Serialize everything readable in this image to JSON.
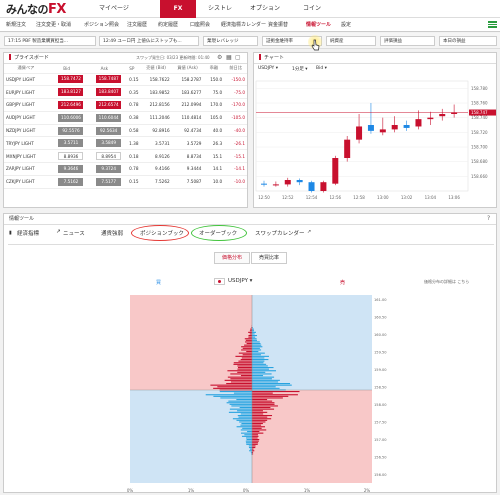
{
  "app": {
    "logo_text": "みんなの",
    "logo_fx": "FX",
    "nav_tabs": [
      "マイページ",
      "FX",
      "シストレ",
      "オプション",
      "コイン"
    ],
    "active_tab": "FX"
  },
  "menu": {
    "items": [
      "新規注文",
      "注文変更・取消",
      "ポジション照会",
      "注文履歴",
      "約定履歴",
      "口座照会",
      "経済指標カレンダー",
      "資金振替",
      "情報ツール",
      "設定"
    ]
  },
  "tickers": [
    {
      "label": "17:15 PBF 製造業購買担当..."
    },
    {
      "label": "12:49 ユーロ円 上値仏にストップも..."
    },
    {
      "label": "業現レバレッジ"
    },
    {
      "label": "証拠金維持率"
    },
    {
      "label": "純資産"
    },
    {
      "label": "評価損益"
    },
    {
      "label": "本日の損益"
    }
  ],
  "rateboard": {
    "title": "プライスボード",
    "swap_info": "スワップ発生日: 03/23 更新時間: 01:40",
    "columns": [
      "通貨ペア",
      "Bid",
      "Ask",
      "SP",
      "売値 (Bid)",
      "買値 (Ask)",
      "乖離",
      "前日比"
    ],
    "rows": [
      {
        "pair": "USDJPY LIGHT",
        "bid": "158.7472",
        "ask": "158.7487",
        "bid_style": "red",
        "ask_style": "red",
        "sp": "0.15",
        "sell": "158.7622",
        "buy": "158.2787",
        "dev": "150.0",
        "chg": "-150.0"
      },
      {
        "pair": "EURJPY LIGHT",
        "bid": "183.8127",
        "ask": "183.8407",
        "bid_style": "red",
        "ask_style": "red",
        "sp": "0.35",
        "sell": "183.9852",
        "buy": "183.6277",
        "dev": "75.0",
        "chg": "-75.0"
      },
      {
        "pair": "GBPJPY LIGHT",
        "bid": "212.6496",
        "ask": "212.6574",
        "bid_style": "red",
        "ask_style": "red",
        "sp": "0.78",
        "sell": "212.8156",
        "buy": "212.0994",
        "dev": "170.0",
        "chg": "-170.0"
      },
      {
        "pair": "AUDJPY LIGHT",
        "bid": "110.6006",
        "ask": "110.6044",
        "bid_style": "gray",
        "ask_style": "gray",
        "sp": "0.38",
        "sell": "111.2046",
        "buy": "110.4814",
        "dev": "105.0",
        "chg": "-105.0"
      },
      {
        "pair": "NZDJPY LIGHT",
        "bid": "92.5576",
        "ask": "92.5634",
        "bid_style": "gray",
        "ask_style": "gray",
        "sp": "0.58",
        "sell": "92.8916",
        "buy": "92.4734",
        "dev": "40.0",
        "chg": "-40.0"
      },
      {
        "pair": "TRYJPY LIGHT",
        "bid": "3.5711",
        "ask": "3.5849",
        "bid_style": "gray",
        "ask_style": "gray",
        "sp": "1.38",
        "sell": "3.5731",
        "buy": "3.5729",
        "dev": "26.3",
        "chg": "-26.1"
      },
      {
        "pair": "MXNJPY LIGHT",
        "bid": "8.8936",
        "ask": "8.8954",
        "bid_style": "white",
        "ask_style": "white",
        "sp": "0.18",
        "sell": "8.9126",
        "buy": "8.8734",
        "dev": "15.1",
        "chg": "-15.1"
      },
      {
        "pair": "ZARJPY LIGHT",
        "bid": "9.3646",
        "ask": "9.3724",
        "bid_style": "gray",
        "ask_style": "gray",
        "sp": "0.78",
        "sell": "9.4166",
        "buy": "9.3444",
        "dev": "14.1",
        "chg": "-14.1"
      },
      {
        "pair": "CZKJPY LIGHT",
        "bid": "7.5162",
        "ask": "7.5177",
        "bid_style": "gray",
        "ask_style": "gray",
        "sp": "0.15",
        "sell": "7.5262",
        "buy": "7.5087",
        "dev": "10.0",
        "chg": "-10.0"
      }
    ]
  },
  "chart": {
    "title": "チャート",
    "symbol": "USDJPY",
    "timeframe": "1分足",
    "side": "Bid",
    "current_price": "158.747",
    "y_ticks": [
      "158.780",
      "158.760",
      "158.740",
      "158.720",
      "158.700",
      "158.680",
      "158.660"
    ],
    "x_ticks": [
      "12:50",
      "12:52",
      "12:54",
      "12:56",
      "12:58",
      "13:00",
      "13:02",
      "13:04",
      "13:06"
    ],
    "color_up": "#c8102e",
    "color_down": "#1e88e5"
  },
  "chart_data": {
    "type": "candlestick",
    "x": [
      "12:50",
      "12:51",
      "12:52",
      "12:53",
      "12:54",
      "12:55",
      "12:56",
      "12:57",
      "12:58",
      "12:59",
      "13:00",
      "13:01",
      "13:02",
      "13:03",
      "13:04",
      "13:05",
      "13:06"
    ],
    "open": [
      158.65,
      158.649,
      158.649,
      158.655,
      158.652,
      158.64,
      158.65,
      158.685,
      158.71,
      158.73,
      158.72,
      158.724,
      158.73,
      158.728,
      158.738,
      158.742,
      158.745
    ],
    "close": [
      158.649,
      158.649,
      158.655,
      158.652,
      158.64,
      158.652,
      158.685,
      158.71,
      158.728,
      158.722,
      158.724,
      158.73,
      158.726,
      158.738,
      158.74,
      158.745,
      158.747
    ],
    "high": [
      158.654,
      158.653,
      158.658,
      158.657,
      158.654,
      158.654,
      158.688,
      158.715,
      158.745,
      158.76,
      158.74,
      158.742,
      158.736,
      158.75,
      158.748,
      158.752,
      158.758
    ],
    "low": [
      158.646,
      158.646,
      158.646,
      158.648,
      158.638,
      158.638,
      158.648,
      158.68,
      158.705,
      158.718,
      158.716,
      158.72,
      158.722,
      158.724,
      158.73,
      158.736,
      158.74
    ],
    "ylim": [
      158.64,
      158.79
    ]
  },
  "infotool": {
    "title": "情報ツール",
    "tabs": [
      "経済指標",
      "ニュース",
      "通貨強弱",
      "ポジションブック",
      "オーダーブック",
      "スワップカレンダー"
    ],
    "sub_tabs": [
      "価格分布",
      "売買比率"
    ],
    "buy_label": "買",
    "sell_label": "売",
    "symbol": "USDJPY",
    "note": "価格分布の詳細は こちら",
    "x_ticks": [
      "0%",
      "1%",
      "2%",
      "1%",
      "0%",
      "1%",
      "2%"
    ],
    "y_ticks": [
      "161.00",
      "160.50",
      "160.00",
      "159.50",
      "159.00",
      "158.50",
      "158.00",
      "157.50",
      "157.00",
      "156.50",
      "156.00"
    ],
    "circle_red": "#e53935",
    "circle_green": "#43c43e",
    "color_sell_bg": "#f8c8c8",
    "color_buy_bg": "#cfe4f5"
  }
}
